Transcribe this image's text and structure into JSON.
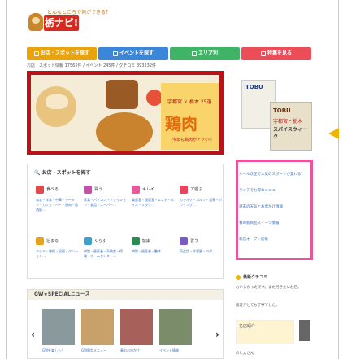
{
  "site": {
    "tagline": "とんなところで何ができる？",
    "logo_text": "栃ナビ!"
  },
  "nav": [
    {
      "label": "お店・スポットを探す"
    },
    {
      "label": "イベントを探す"
    },
    {
      "label": "エリア別"
    },
    {
      "label": "特集を見る"
    }
  ],
  "stats": {
    "text": "お店・スポット情報 17565件 / イベント 245件 / クチコミ 393232件"
  },
  "hero": {
    "subtitle": "宇都宮 × 栃木 25選",
    "main": "鶏肉",
    "note": "今年も鶏肉がアツい!!"
  },
  "ad": {
    "brand": "TOBU",
    "mag_title": "TOBU",
    "mag_sub": "宇都宮・栃木",
    "mag_head": "スパイスウィーク"
  },
  "search": {
    "title": "お店・スポットを探す",
    "categories": [
      {
        "name": "食べる",
        "desc": "和食・洋食・中華・ラーメン・カフェ・バー・焼肉・居酒屋…",
        "color": "#e04a4a"
      },
      {
        "name": "買う",
        "desc": "家電・パソコン・ファッション・食品・スーパー…",
        "color": "#c64fa8"
      },
      {
        "name": "キレイ",
        "desc": "美容室・理容室・エステ・ネイル・リラク…",
        "color": "#e85a9b"
      },
      {
        "name": "ア遊ぶ",
        "desc": "カラオケ・ゴルフ・温泉・ボウリング…",
        "color": "#e8445a"
      },
      {
        "name": "泊まる",
        "desc": "ホテル・旅館・民宿・ペンション…",
        "color": "#e6a21a"
      },
      {
        "name": "くらす",
        "desc": "病院・歯医者・不動産・保険・ホームセンター…",
        "color": "#3fa0c8"
      },
      {
        "name": "健康",
        "desc": "病院・歯医者・整体…",
        "color": "#2e8b57"
      },
      {
        "name": "習う",
        "desc": "英会話・学習塾・ヨガ…",
        "color": "#7a5bc4"
      }
    ]
  },
  "gw": {
    "title": "GW★SPECIALニュース",
    "items": [
      {
        "caption": "GWを楽しもう"
      },
      {
        "caption": "GW限定メニュー"
      },
      {
        "caption": "春のお出かけ"
      },
      {
        "caption": "イベント情報"
      }
    ]
  },
  "news": [
    {
      "text": "ルール改正で人気のスポーツが変わる？"
    },
    {
      "text": "ランチでお得なメニュー"
    },
    {
      "text": "週末の天気とお出かけ情報"
    },
    {
      "text": "春の新商品スイーツ情報"
    },
    {
      "text": "新店オープン速報"
    }
  ],
  "side": {
    "section": "最新クチコミ",
    "lines": [
      "おいしかったです。また行きたいお店。",
      "接客がとても丁寧でした。"
    ],
    "box": "名店紹介",
    "footer": "のし太さん"
  }
}
